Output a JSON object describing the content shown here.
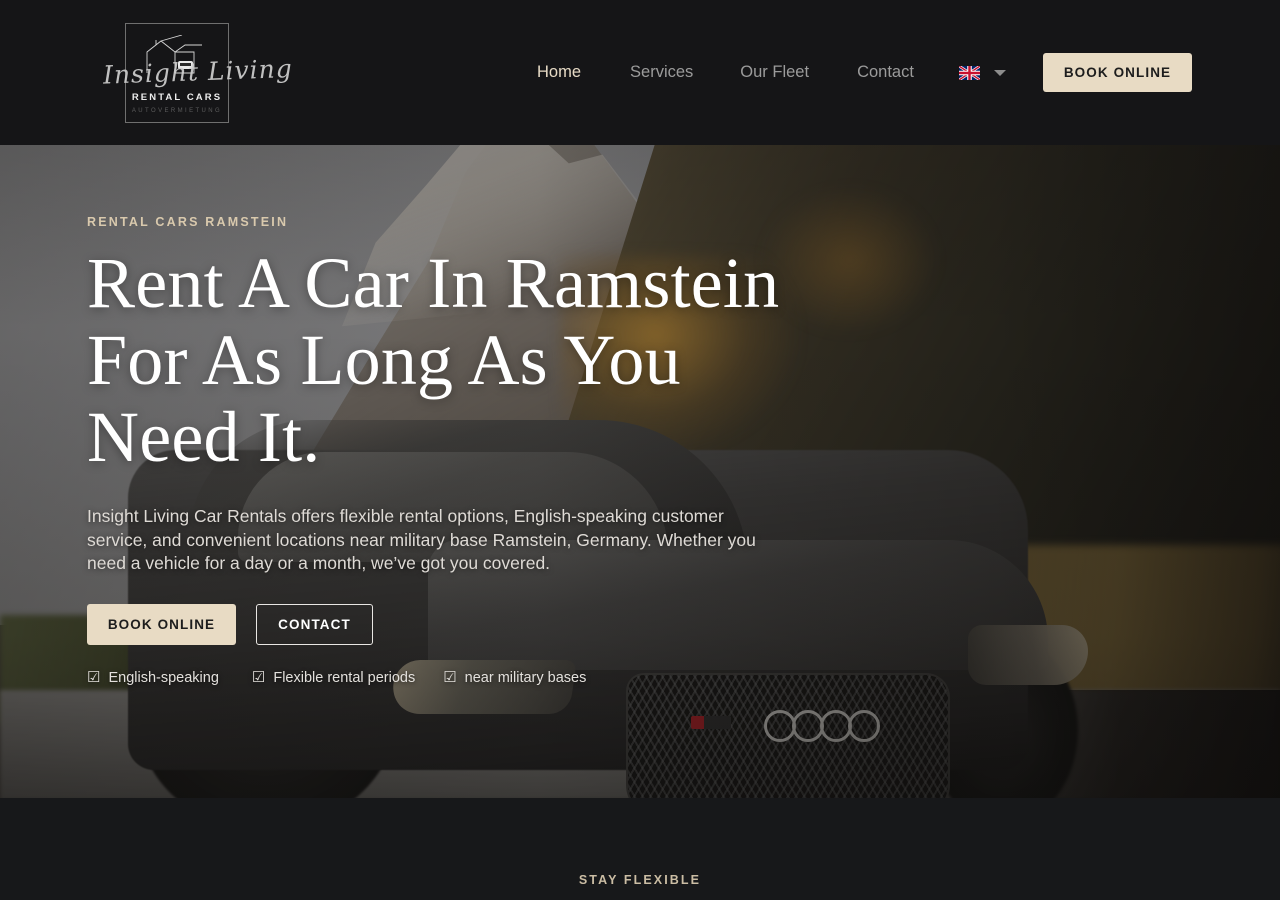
{
  "brand": {
    "script_name": "Insight Living",
    "line1": "RENTAL CARS",
    "line2": "AUTOVERMIETUNG",
    "icon": "garage-house-car-icon"
  },
  "header": {
    "nav": [
      {
        "label": "Home",
        "active": true
      },
      {
        "label": "Services",
        "active": false
      },
      {
        "label": "Our Fleet",
        "active": false
      },
      {
        "label": "Contact",
        "active": false
      }
    ],
    "language": {
      "flag": "uk-flag-icon",
      "chevron": "chevron-down-icon"
    },
    "cta_label": "BOOK ONLINE",
    "background": "#151517"
  },
  "hero": {
    "eyebrow": "RENTAL CARS RAMSTEIN",
    "title": "Rent A Car In Ramstein For As Long As You Need It.",
    "paragraph": "Insight Living Car Rentals offers flexible rental options, English-speaking customer service, and convenient locations near military base Ramstein, Germany. Whether you need a vehicle for a day or a month, we’ve got you covered.",
    "primary_cta": "BOOK ONLINE",
    "secondary_cta": "CONTACT",
    "features": [
      {
        "icon": "checkbox-checked-icon",
        "label": "English-speaking"
      },
      {
        "icon": "checkbox-checked-icon",
        "label": "Flexible rental periods"
      },
      {
        "icon": "checkbox-checked-icon",
        "label": "near military bases"
      }
    ],
    "background_image": "dark-audi-rs5-driving-mountain-road"
  },
  "next_section": {
    "eyebrow": "STAY FLEXIBLE"
  },
  "colors": {
    "accent_cream": "#e8dbc4",
    "accent_tan_text": "#d9c9ad",
    "header_bg": "#151517",
    "section_bg": "#17181a",
    "nav_inactive": "#9b9b9b"
  },
  "glyphs": {
    "checkbox": "☑"
  }
}
